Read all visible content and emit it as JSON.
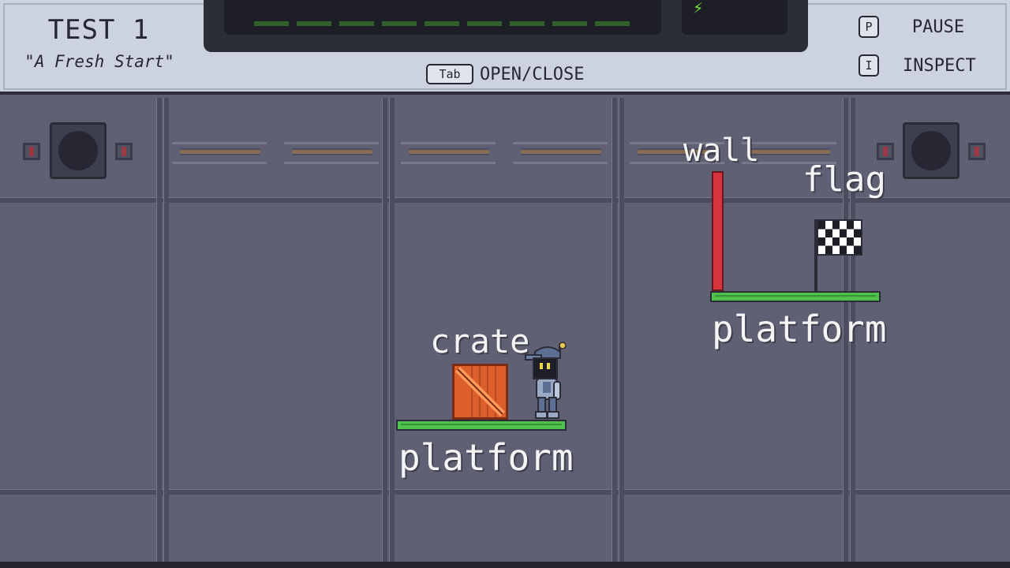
{
  "hud": {
    "level_title": "TEST 1",
    "level_subtitle": "\"A Fresh Start\"",
    "open_close_key": "Tab",
    "open_close_label": "OPEN/CLOSE",
    "pause_key": "P",
    "pause_label": "PAUSE",
    "inspect_key": "I",
    "inspect_label": "INSPECT",
    "energy_icon": "lightning-bolt-icon",
    "energy_color": "#6fdc3c"
  },
  "scene": {
    "labels": {
      "crate": "crate",
      "platform_left": "platform",
      "wall": "wall",
      "flag": "flag",
      "platform_right": "platform"
    },
    "colors": {
      "background": "#5f6073",
      "platform": "#4ec24a",
      "crate": "#dc5e2b",
      "wall": "#d8343e",
      "hud": "#cdd3de"
    }
  }
}
